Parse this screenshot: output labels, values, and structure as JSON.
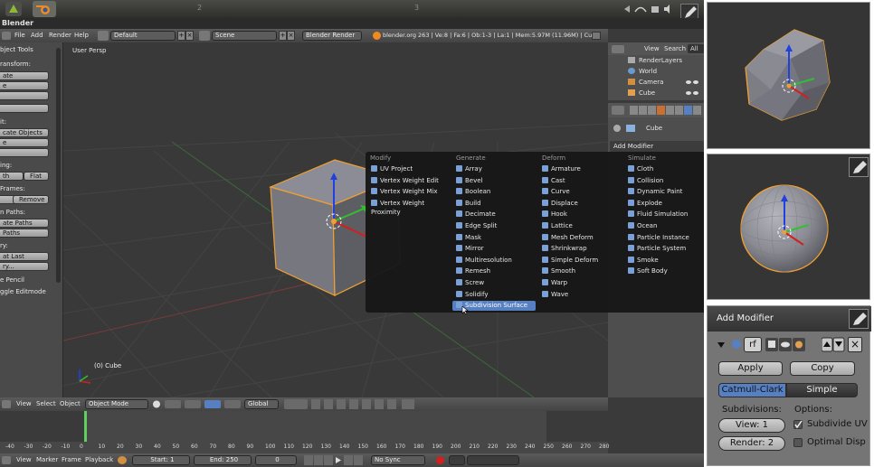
{
  "window": {
    "title": "Blender"
  },
  "ubuntu_bar": {
    "workspace_2": "2",
    "workspace_3": "3"
  },
  "info_header": {
    "menus": [
      "File",
      "Add",
      "Render",
      "Help"
    ],
    "screen": "Default",
    "scene": "Scene",
    "engine": "Blender Render",
    "stats": "blender.org 263 | Ve:8 | Fa:6 | Ob:1-3 | La:1 | Mem:5.97M (11.96M) | Cube"
  },
  "tool_shelf": {
    "title": "bject Tools",
    "labels": [
      "form:",
      "ate",
      "e",
      "",
      "",
      "it:",
      "cate Objects",
      "ate",
      "",
      "ing:",
      "th",
      "Flat",
      "mes:",
      "Remove",
      "n Paths:",
      "ate Paths",
      "Paths",
      "ry:",
      "at Last",
      "ry...",
      "e Pencil",
      "ggle Editmode"
    ],
    "sections": {
      "s1": "ransform:",
      "b1": "ate",
      "b2": "e",
      "s2": "it:",
      "b3": "cate Objects",
      "b4": "e",
      "s3": "ing:",
      "b5a": "th",
      "b5b": "Flat",
      "s4": "Frames:",
      "b6": "Remove",
      "s5": "n Paths:",
      "b7": "ate Paths",
      "b8": "Paths",
      "s6": "ry:",
      "b9": "at Last",
      "b10": "ry...",
      "s7": "e Pencil",
      "s8": "ggle Editmode"
    }
  },
  "viewport": {
    "label": "User Persp",
    "object_label": "(0) Cube"
  },
  "modifier_menu": {
    "columns": [
      {
        "header": "Modify",
        "items": [
          "UV Project",
          "Vertex Weight Edit",
          "Vertex Weight Mix",
          "Vertex Weight Proximity"
        ]
      },
      {
        "header": "Generate",
        "items": [
          "Array",
          "Bevel",
          "Boolean",
          "Build",
          "Decimate",
          "Edge Split",
          "Mask",
          "Mirror",
          "Multiresolution",
          "Remesh",
          "Screw",
          "Solidify",
          "Subdivision Surface"
        ]
      },
      {
        "header": "Deform",
        "items": [
          "Armature",
          "Cast",
          "Curve",
          "Displace",
          "Hook",
          "Lattice",
          "Mesh Deform",
          "Shrinkwrap",
          "Simple Deform",
          "Smooth",
          "Warp",
          "Wave"
        ]
      },
      {
        "header": "Simulate",
        "items": [
          "Cloth",
          "Collision",
          "Dynamic Paint",
          "Explode",
          "Fluid Simulation",
          "Ocean",
          "Particle Instance",
          "Particle System",
          "Smoke",
          "Soft Body"
        ]
      }
    ],
    "selected": "Subdivision Surface"
  },
  "outliner": {
    "view": "View",
    "search": "Search",
    "all": "All",
    "items": [
      "RenderLayers",
      "World",
      "Camera",
      "Cube"
    ]
  },
  "properties": {
    "object": "Cube",
    "add_modifier": "Add Modifier"
  },
  "viewport_header": {
    "menus": [
      "View",
      "Select",
      "Object"
    ],
    "mode": "Object Mode",
    "orientation": "Global"
  },
  "timeline": {
    "ticks": [
      "-40",
      "-30",
      "-20",
      "-10",
      "0",
      "10",
      "20",
      "30",
      "40",
      "50",
      "60",
      "70",
      "80",
      "90",
      "100",
      "110",
      "120",
      "130",
      "140",
      "150",
      "160",
      "170",
      "180",
      "190",
      "200",
      "210",
      "220",
      "230",
      "240",
      "250",
      "260",
      "270",
      "280"
    ]
  },
  "timeline_header": {
    "menus": [
      "View",
      "Marker",
      "Frame",
      "Playback"
    ],
    "start": "Start: 1",
    "end": "End: 250",
    "current": "0",
    "sync": "No Sync"
  },
  "subsurf_panel": {
    "title": "Add Modifier",
    "name_field": "rf",
    "apply": "Apply",
    "copy": "Copy",
    "tab_catmull": "Catmull-Clark",
    "tab_simple": "Simple",
    "subdivisions_label": "Subdivisions:",
    "options_label": "Options:",
    "view": "View: 1",
    "render": "Render: 2",
    "subdivide_uv": "Subdivide UV",
    "optimal_display": "Optimal Disp"
  },
  "colors": {
    "accent": "#5680c2",
    "origin_orange": "#f0a030",
    "axis_x": "#d02020",
    "axis_y": "#30c030",
    "axis_z": "#2040e0"
  }
}
